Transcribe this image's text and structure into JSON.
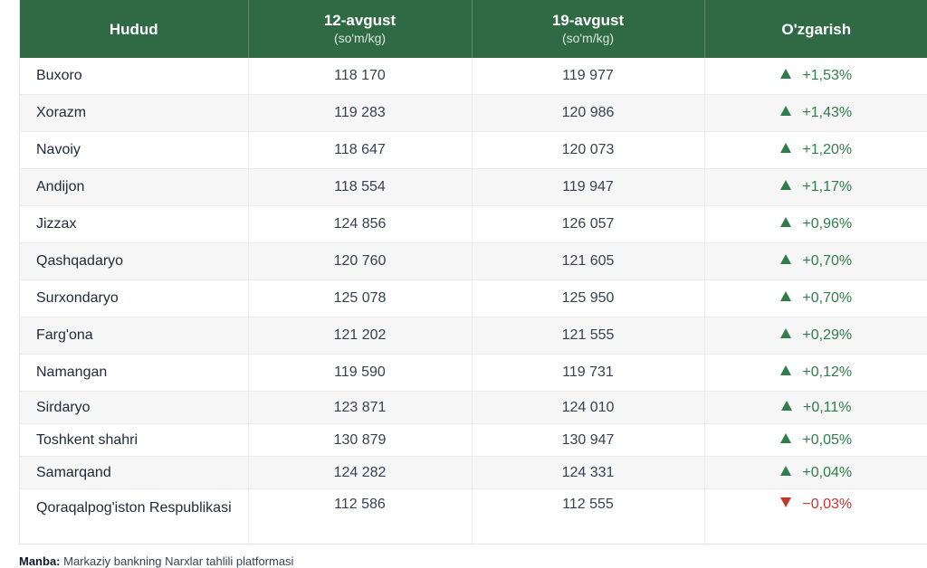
{
  "table": {
    "headers": {
      "region": "Hudud",
      "date1": "12-avgust",
      "date1_unit": "(so'm/kg)",
      "date2": "19-avgust",
      "date2_unit": "(so'm/kg)",
      "change": "O'zgarish"
    },
    "rows": [
      {
        "region": "Buxoro",
        "v1": "118 170",
        "v2": "119 977",
        "change": "+1,53%",
        "direction": "up"
      },
      {
        "region": "Xorazm",
        "v1": "119 283",
        "v2": "120 986",
        "change": "+1,43%",
        "direction": "up"
      },
      {
        "region": "Navoiy",
        "v1": "118 647",
        "v2": "120 073",
        "change": "+1,20%",
        "direction": "up"
      },
      {
        "region": "Andijon",
        "v1": "118 554",
        "v2": "119 947",
        "change": "+1,17%",
        "direction": "up"
      },
      {
        "region": "Jizzax",
        "v1": "124 856",
        "v2": "126 057",
        "change": "+0,96%",
        "direction": "up"
      },
      {
        "region": "Qashqadaryo",
        "v1": "120 760",
        "v2": "121 605",
        "change": "+0,70%",
        "direction": "up"
      },
      {
        "region": "Surxondaryo",
        "v1": "125 078",
        "v2": "125 950",
        "change": "+0,70%",
        "direction": "up"
      },
      {
        "region": "Farg'ona",
        "v1": "121 202",
        "v2": "121 555",
        "change": "+0,29%",
        "direction": "up"
      },
      {
        "region": "Namangan",
        "v1": "119 590",
        "v2": "119 731",
        "change": "+0,12%",
        "direction": "up"
      },
      {
        "region": "Sirdaryo",
        "v1": "123 871",
        "v2": "124 010",
        "change": "+0,11%",
        "direction": "up"
      },
      {
        "region": "Toshkent shahri",
        "v1": "130 879",
        "v2": "130 947",
        "change": "+0,05%",
        "direction": "up"
      },
      {
        "region": "Samarqand",
        "v1": "124 282",
        "v2": "124 331",
        "change": "+0,04%",
        "direction": "up"
      },
      {
        "region": "Qoraqalpog'iston Respublikasi",
        "v1": "112 586",
        "v2": "112 555",
        "change": "−0,03%",
        "direction": "down"
      }
    ]
  },
  "source": {
    "label": "Manba:",
    "text": "Markaziy bankning Narxlar tahlili platformasi"
  },
  "colors": {
    "header_bg": "#2f6a45",
    "up": "#2f7d4a",
    "down": "#c0392b",
    "stripe": "#f5f6f5"
  },
  "icons": {
    "up": "triangle-up-icon",
    "down": "triangle-down-icon"
  }
}
